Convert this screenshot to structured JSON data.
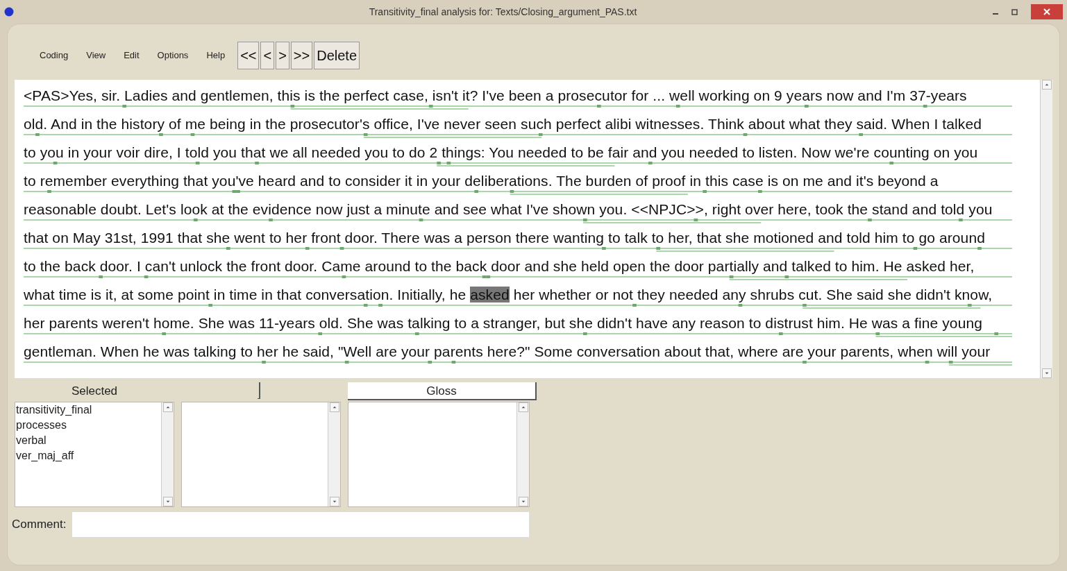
{
  "window": {
    "title": "Transitivity_final analysis for: Texts/Closing_argument_PAS.txt"
  },
  "menu": [
    "Coding",
    "View",
    "Edit",
    "Options",
    "Help"
  ],
  "toolbar": [
    "<<",
    "<",
    ">",
    ">>",
    "Delete"
  ],
  "text_lines": [
    [
      {
        "text": "<PAS>Yes, sir. Ladies and gentlemen, this is the perfect case, isn't it? I've been a prosecutor for ... well working on 9 years now and I'm 37-years",
        "selected": false
      }
    ],
    [
      {
        "text": "old. And in the history of me being in the prosecutor's office, I've never seen such perfect alibi witnesses. Think about what they said. When I talked",
        "selected": false
      }
    ],
    [
      {
        "text": "to you in your voir dire, I told you that we all needed you to do 2 things: You needed to be fair and you needed to listen. Now we're counting on you",
        "selected": false
      }
    ],
    [
      {
        "text": "to remember everything that you've heard and to consider it in your deliberations. The burden of proof in this case is on me and it's beyond a",
        "selected": false
      }
    ],
    [
      {
        "text": "reasonable doubt. Let's look at the evidence now just a minute and see what I've shown you. <<NPJC>>, right over here, took the stand and told you",
        "selected": false
      }
    ],
    [
      {
        "text": "that on May 31st, 1991 that she went to her front door. There was a person there wanting to talk to her, that she motioned and told him to go around",
        "selected": false
      }
    ],
    [
      {
        "text": "to the back door. I can't unlock the front door. Came around to the back door and she held open the door partially and talked to him. He asked her,",
        "selected": false
      }
    ],
    [
      {
        "text": "what time is it, at some point in time in that conversation. Initially, he ",
        "selected": false
      },
      {
        "text": "asked",
        "selected": true
      },
      {
        "text": " her whether or not they needed any shrubs cut. She said she didn't know,",
        "selected": false
      }
    ],
    [
      {
        "text": "her parents weren't home. She was 11-years old. She was talking to a stranger, but she didn't have any reason to distrust him. He was a fine young",
        "selected": false
      }
    ],
    [
      {
        "text": "gentleman. When he was talking to her he said, \"Well are your parents here?\" Some conversation about that, where are your parents, when will your",
        "selected": false
      }
    ]
  ],
  "panels": [
    {
      "header": "Selected",
      "items": [
        "transitivity_final",
        "processes",
        "verbal",
        "ver_maj_aff"
      ]
    },
    {
      "header": "Gloss"
    }
  ],
  "comment": {
    "label": "Comment:"
  }
}
